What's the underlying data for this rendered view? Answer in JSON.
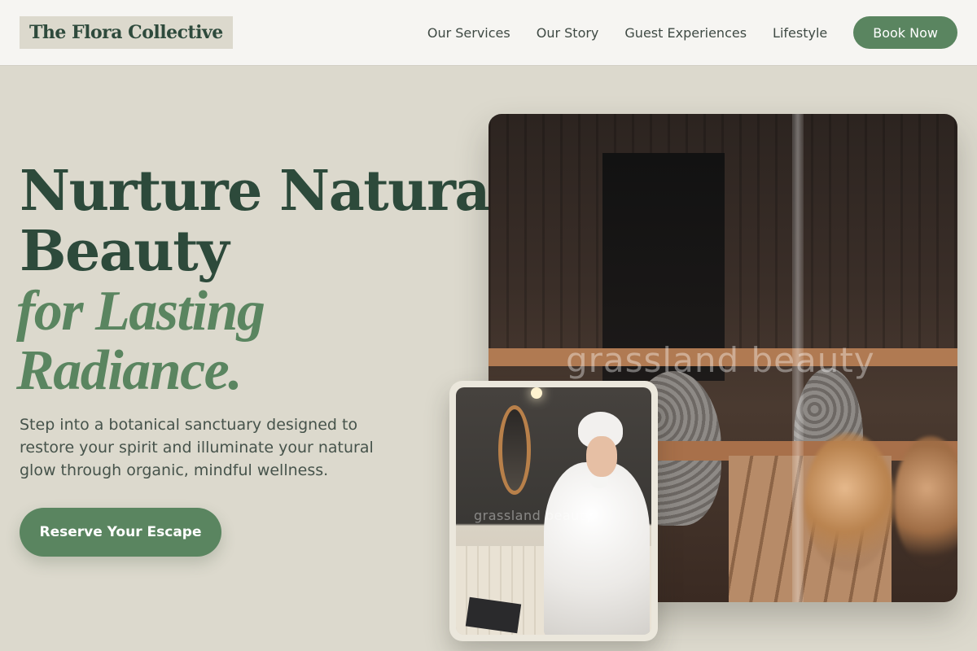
{
  "brand": {
    "name": "The Flora Collective"
  },
  "nav": {
    "items": [
      {
        "label": "Our Services"
      },
      {
        "label": "Our Story"
      },
      {
        "label": "Guest Experiences"
      },
      {
        "label": "Lifestyle"
      }
    ],
    "book_label": "Book Now"
  },
  "hero": {
    "headline_line1": "Nurture Natural",
    "headline_line2": "Beauty",
    "headline_italic_line1": "for Lasting",
    "headline_italic_line2": "Radiance.",
    "subtitle": "Step into a botanical sanctuary designed to restore your spirit and illuminate your natural glow through organic, mindful wellness.",
    "cta_label": "Reserve Your Escape"
  },
  "images": {
    "main_watermark": "grassland beauty",
    "card_watermark": "grassland beauty"
  },
  "colors": {
    "accent": "#5a8560",
    "headline": "#2d4a3b",
    "background": "#dcd9cd",
    "header_background": "#f6f5f2"
  }
}
